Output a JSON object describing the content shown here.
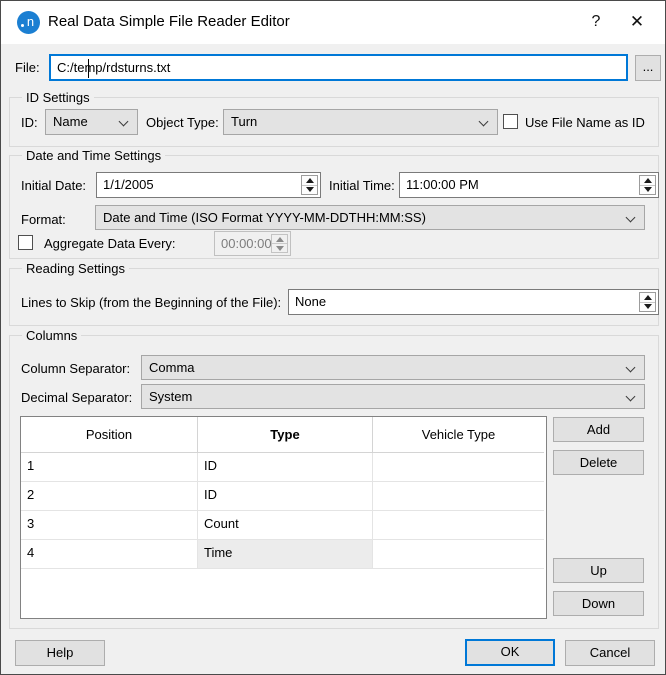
{
  "window": {
    "title": "Real Data Simple File Reader Editor",
    "icon_letter": "n",
    "help_glyph": "?",
    "close_glyph": "✕"
  },
  "file": {
    "label": "File:",
    "value": "C:/temp/rdsturns.txt",
    "browse_label": "..."
  },
  "id_settings": {
    "title": "ID Settings",
    "id_label": "ID:",
    "id_value": "Name",
    "object_type_label": "Object Type:",
    "object_type_value": "Turn",
    "use_file_name_label": "Use File Name as ID",
    "use_file_name_checked": false
  },
  "datetime_settings": {
    "title": "Date and Time Settings",
    "initial_date_label": "Initial Date:",
    "initial_date_value": "1/1/2005",
    "initial_time_label": "Initial Time:",
    "initial_time_value": "11:00:00 PM",
    "format_label": "Format:",
    "format_value": "Date and Time (ISO Format YYYY-MM-DDTHH:MM:SS)",
    "aggregate_label": "Aggregate Data Every:",
    "aggregate_value": "00:00:00",
    "aggregate_checked": false
  },
  "reading_settings": {
    "title": "Reading Settings",
    "lines_to_skip_label": "Lines to Skip (from the Beginning of the File):",
    "lines_to_skip_value": "None"
  },
  "columns": {
    "title": "Columns",
    "column_separator_label": "Column Separator:",
    "column_separator_value": "Comma",
    "decimal_separator_label": "Decimal Separator:",
    "decimal_separator_value": "System",
    "table": {
      "headers": [
        "Position",
        "Type",
        "Vehicle Type"
      ],
      "rows": [
        [
          "1",
          "ID",
          ""
        ],
        [
          "2",
          "ID",
          ""
        ],
        [
          "3",
          "Count",
          ""
        ],
        [
          "4",
          "Time",
          ""
        ]
      ],
      "selected_cell": {
        "row": 3,
        "col": 1
      }
    },
    "buttons": {
      "add": "Add",
      "delete": "Delete",
      "up": "Up",
      "down": "Down"
    }
  },
  "footer": {
    "help": "Help",
    "ok": "OK",
    "cancel": "Cancel"
  },
  "colors": {
    "accent": "#0078d7",
    "logo_blue": "#1b7fd2",
    "dialog_bg": "#f0f0f0"
  }
}
